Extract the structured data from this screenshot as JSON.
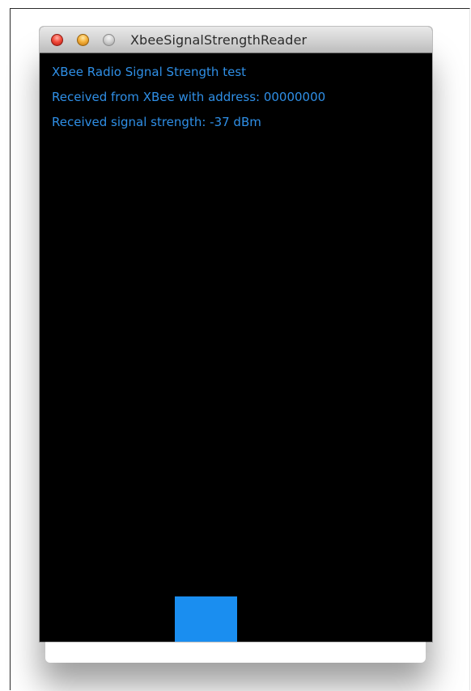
{
  "window": {
    "title": "XbeeSignalStrengthReader",
    "controls": {
      "close_icon": "close-icon",
      "minimize_icon": "minimize-icon",
      "zoom_icon": "zoom-icon"
    }
  },
  "content": {
    "heading": "XBee Radio Signal Strength test",
    "address_line": "Received from XBee with address: 00000000",
    "signal_line": "Received signal strength: -37 dBm"
  },
  "signal_bar": {
    "level_fraction": 0.077,
    "color": "#1a8ef0"
  },
  "colors": {
    "background": "#000000",
    "text": "#2f8fe6"
  }
}
